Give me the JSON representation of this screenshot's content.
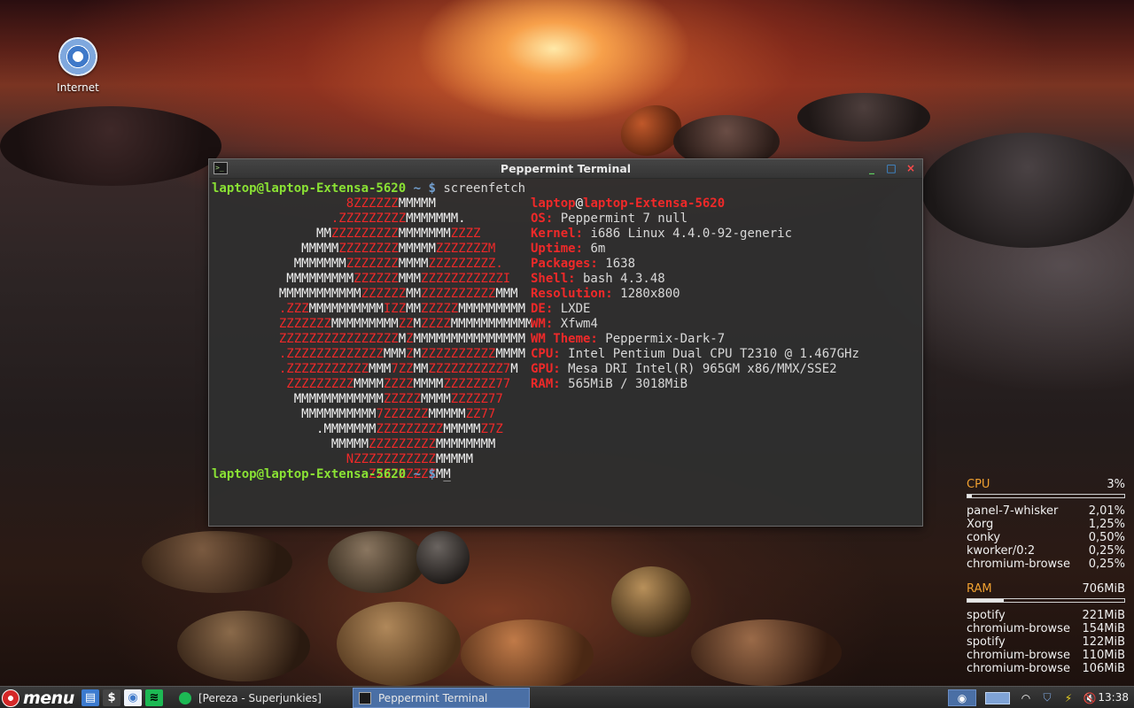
{
  "desktop": {
    "icons": [
      {
        "label": "Internet",
        "icon": "chromium-icon"
      }
    ]
  },
  "terminal": {
    "title": "Peppermint Terminal",
    "user": "laptop@laptop-Extensa-5620",
    "path": "~",
    "dollar": "$",
    "command": "screenfetch",
    "cursor": "_",
    "ascii_lines": [
      [
        [
          "                  ",
          "w"
        ],
        [
          "8ZZZZZZ",
          "r"
        ],
        [
          "MMMMM",
          "w"
        ]
      ],
      [
        [
          "                ",
          "w"
        ],
        [
          ".ZZZZZZZZZ",
          "r"
        ],
        [
          "MMMMMMM.",
          "w"
        ]
      ],
      [
        [
          "              ",
          "w"
        ],
        [
          "MM",
          "w"
        ],
        [
          "ZZZZZZZZZ",
          "r"
        ],
        [
          "MMMMMMM",
          "w"
        ],
        [
          "ZZZZ",
          "r"
        ]
      ],
      [
        [
          "            ",
          "w"
        ],
        [
          "MMMMM",
          "w"
        ],
        [
          "ZZZZZZZZ",
          "r"
        ],
        [
          "MMMMM",
          "w"
        ],
        [
          "ZZZZZZZM",
          "r"
        ]
      ],
      [
        [
          "           ",
          "w"
        ],
        [
          "MMMMMMM",
          "w"
        ],
        [
          "ZZZZZZZ",
          "r"
        ],
        [
          "MMMM",
          "w"
        ],
        [
          "ZZZZZZZZZ.",
          "r"
        ]
      ],
      [
        [
          "          ",
          "w"
        ],
        [
          "MMMMMMMMM",
          "w"
        ],
        [
          "ZZZZZZ",
          "r"
        ],
        [
          "MMM",
          "w"
        ],
        [
          "ZZZZZZZZZZZI",
          "r"
        ]
      ],
      [
        [
          "         ",
          "w"
        ],
        [
          "MMMMMMMMMMM",
          "w"
        ],
        [
          "ZZZZZZ",
          "r"
        ],
        [
          "MM",
          "w"
        ],
        [
          "ZZZZZZZZZZ",
          "r"
        ],
        [
          "MMM",
          "w"
        ]
      ],
      [
        [
          "         ",
          "w"
        ],
        [
          ".ZZZ",
          "r"
        ],
        [
          "MMMMMMMMMM",
          "w"
        ],
        [
          "IZZ",
          "r"
        ],
        [
          "MM",
          "w"
        ],
        [
          "ZZZZZ",
          "r"
        ],
        [
          "MMMMMMMMM",
          "w"
        ]
      ],
      [
        [
          "         ",
          "w"
        ],
        [
          "ZZZZZZZ",
          "r"
        ],
        [
          "MMMMMMMMM",
          "w"
        ],
        [
          "ZZ",
          "r"
        ],
        [
          "M",
          "w"
        ],
        [
          "ZZZZ",
          "r"
        ],
        [
          "MMMMMMMMMMM",
          "w"
        ]
      ],
      [
        [
          "         ",
          "w"
        ],
        [
          "ZZZZZZZZZZZZZZZZ",
          "r"
        ],
        [
          "M",
          "w"
        ],
        [
          "Z",
          "r"
        ],
        [
          "MMMMMMMMMMMMMMM",
          "w"
        ]
      ],
      [
        [
          "         ",
          "w"
        ],
        [
          ".ZZZZZZZZZZZZZ",
          "r"
        ],
        [
          "MMM",
          "w"
        ],
        [
          "Z",
          "r"
        ],
        [
          "M",
          "w"
        ],
        [
          "ZZZZZZZZZZ",
          "r"
        ],
        [
          "MMMM",
          "w"
        ]
      ],
      [
        [
          "         ",
          "w"
        ],
        [
          ".ZZZZZZZZZZZ",
          "r"
        ],
        [
          "MMM",
          "w"
        ],
        [
          "7ZZ",
          "r"
        ],
        [
          "MM",
          "w"
        ],
        [
          "ZZZZZZZZZZ7",
          "r"
        ],
        [
          "M",
          "w"
        ]
      ],
      [
        [
          "          ",
          "w"
        ],
        [
          "ZZZZZZZZZ",
          "r"
        ],
        [
          "MMMM",
          "w"
        ],
        [
          "ZZZZ",
          "r"
        ],
        [
          "MMMM",
          "w"
        ],
        [
          "ZZZZZZZ77",
          "r"
        ]
      ],
      [
        [
          "           ",
          "w"
        ],
        [
          "MMMMMMMMMMMM",
          "w"
        ],
        [
          "ZZZZZ",
          "r"
        ],
        [
          "MMMM",
          "w"
        ],
        [
          "ZZZZZ77",
          "r"
        ]
      ],
      [
        [
          "            ",
          "w"
        ],
        [
          "MMMMMMMMMM",
          "w"
        ],
        [
          "7ZZZZZZ",
          "r"
        ],
        [
          "MMMMM",
          "w"
        ],
        [
          "ZZ77",
          "r"
        ]
      ],
      [
        [
          "              ",
          "w"
        ],
        [
          ".MMMMMMM",
          "w"
        ],
        [
          "ZZZZZZZZZ",
          "r"
        ],
        [
          "MMMMM",
          "w"
        ],
        [
          "Z7Z",
          "r"
        ]
      ],
      [
        [
          "                ",
          "w"
        ],
        [
          "MMMMM",
          "w"
        ],
        [
          "ZZZZZZZZZ",
          "r"
        ],
        [
          "MMMMMMMM",
          "w"
        ]
      ],
      [
        [
          "                  ",
          "w"
        ],
        [
          "NZZZZZZZZZZZ",
          "r"
        ],
        [
          "MMMMM",
          "w"
        ]
      ],
      [
        [
          "                     ",
          "w"
        ],
        [
          "ZZZZZZZZZ",
          "r"
        ],
        [
          "MM",
          "w"
        ]
      ]
    ],
    "info_header_user": "laptop",
    "info_header_at": "@",
    "info_header_host": "laptop-Extensa-5620",
    "info": [
      {
        "key": "OS:",
        "value": "Peppermint 7 null"
      },
      {
        "key": "Kernel:",
        "value": "i686 Linux 4.4.0-92-generic"
      },
      {
        "key": "Uptime:",
        "value": "6m"
      },
      {
        "key": "Packages:",
        "value": "1638"
      },
      {
        "key": "Shell:",
        "value": "bash 4.3.48"
      },
      {
        "key": "Resolution:",
        "value": "1280x800"
      },
      {
        "key": "DE:",
        "value": "LXDE"
      },
      {
        "key": "WM:",
        "value": "Xfwm4"
      },
      {
        "key": "WM Theme:",
        "value": "Peppermix-Dark-7"
      },
      {
        "key": "CPU:",
        "value": "Intel Pentium Dual CPU T2310 @ 1.467GHz"
      },
      {
        "key": "GPU:",
        "value": "Mesa DRI Intel(R) 965GM x86/MMX/SSE2"
      },
      {
        "key": "RAM:",
        "value": "565MiB / 3018MiB"
      }
    ]
  },
  "conky": {
    "cpu": {
      "label": "CPU",
      "value": "3%",
      "fraction": 0.03,
      "processes": [
        {
          "name": "panel-7-whisker",
          "value": "2,01%"
        },
        {
          "name": "Xorg",
          "value": "1,25%"
        },
        {
          "name": "conky",
          "value": "0,50%"
        },
        {
          "name": "kworker/0:2",
          "value": "0,25%"
        },
        {
          "name": "chromium-browse",
          "value": "0,25%"
        }
      ]
    },
    "ram": {
      "label": "RAM",
      "value": "706MiB",
      "fraction": 0.23,
      "processes": [
        {
          "name": "spotify",
          "value": "221MiB"
        },
        {
          "name": "chromium-browse",
          "value": "154MiB"
        },
        {
          "name": "spotify",
          "value": "122MiB"
        },
        {
          "name": "chromium-browse",
          "value": "110MiB"
        },
        {
          "name": "chromium-browse",
          "value": "106MiB"
        }
      ]
    }
  },
  "taskbar": {
    "menu_label": "menu",
    "launchers": [
      "file-manager-icon",
      "terminal-icon",
      "chromium-icon",
      "spotify-icon"
    ],
    "tasks": [
      {
        "label": "[Pereza - Superjunkies]",
        "icon": "spotify-icon",
        "active": false
      },
      {
        "label": "Peppermint Terminal",
        "icon": "terminal-icon",
        "active": true
      }
    ],
    "tray": [
      "chromium-icon",
      "workspace-icon",
      "wifi-icon",
      "shield-icon",
      "power-icon",
      "volume-muted-icon"
    ],
    "clock": "13:38"
  },
  "colors": {
    "prompt_green": "#8ae234",
    "prompt_blue": "#729fcf",
    "logo_red": "#ef2929",
    "conky_accent": "#f0a030",
    "task_active": "#4a6fa5"
  }
}
